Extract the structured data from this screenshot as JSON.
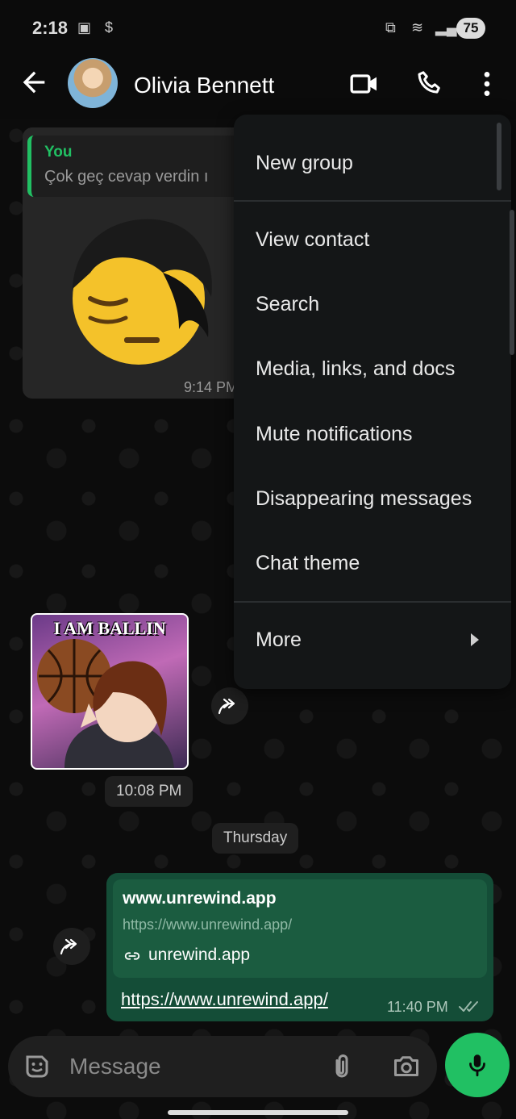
{
  "status_bar": {
    "time": "2:18",
    "battery": "75"
  },
  "header": {
    "contact_name": "Olivia Bennett"
  },
  "messages": {
    "quote": {
      "author": "You",
      "text": "Çok geç cevap verdin ı"
    },
    "sticker_time": "9:14 PM",
    "sticker2_caption": "I AM BALLIN",
    "sticker2_time": "10:08 PM",
    "date_chip": "Thursday",
    "link": {
      "preview_title": "www.unrewind.app",
      "preview_url": "https://www.unrewind.app/",
      "preview_domain": "unrewind.app",
      "body_link": "https://www.unrewind.app/",
      "time": "11:40 PM"
    }
  },
  "composer": {
    "placeholder": "Message"
  },
  "menu": {
    "items": [
      "New group",
      "View contact",
      "Search",
      "Media, links, and docs",
      "Mute notifications",
      "Disappearing messages",
      "Chat theme",
      "More"
    ]
  },
  "colors": {
    "accent": "#21c063",
    "outgoing_bubble": "#144d37",
    "menu_bg": "#141617"
  }
}
